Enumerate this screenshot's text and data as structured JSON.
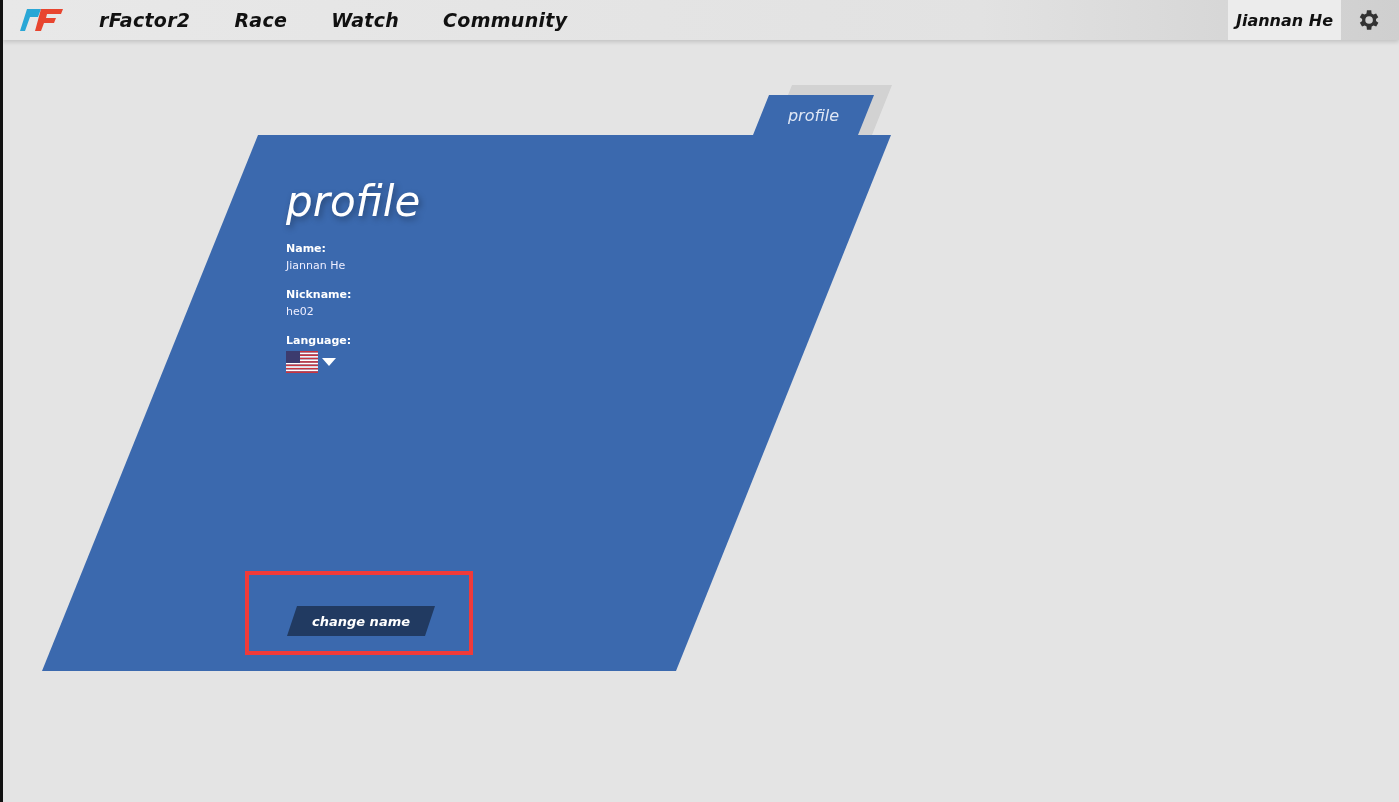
{
  "nav": {
    "items": [
      {
        "label": "rFactor2"
      },
      {
        "label": "Race"
      },
      {
        "label": "Watch"
      },
      {
        "label": "Community"
      }
    ],
    "user": "Jiannan He"
  },
  "profile": {
    "tab": "profile",
    "title": "profile",
    "fields": [
      {
        "label": "Name:",
        "value": "Jiannan He"
      },
      {
        "label": "Nickname:",
        "value": "he02"
      }
    ],
    "language_label": "Language:",
    "button": "change name"
  }
}
